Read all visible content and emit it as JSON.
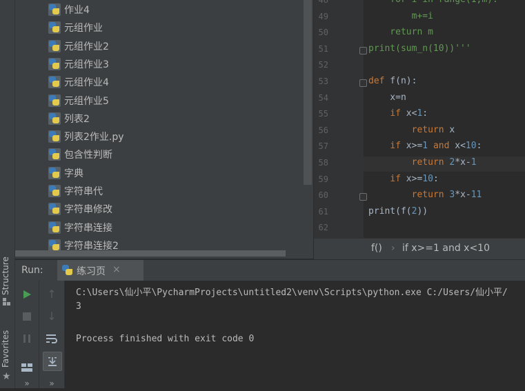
{
  "left_strip": {
    "structure_label": "Structure",
    "favorites_label": "Favorites"
  },
  "project_tree": {
    "items": [
      "作业4",
      "元组作业",
      "元组作业2",
      "元组作业3",
      "元组作业4",
      "元组作业5",
      "列表2",
      "列表2作业.py",
      "包含性判断",
      "字典",
      "字符串代",
      "字符串修改",
      "字符串连接",
      "字符串连接2"
    ]
  },
  "editor": {
    "line_numbers": [
      "48",
      "49",
      "50",
      "51",
      "52",
      "53",
      "54",
      "55",
      "56",
      "57",
      "58",
      "59",
      "60",
      "61",
      "62"
    ],
    "lines": [
      "    for i in range(1,m):",
      "        m+=i",
      "    return m",
      "print(sum_n(10))'''",
      "",
      "def f(n):",
      "    x=n",
      "    if x<1:",
      "        return x",
      "    if x>=1 and x<10:",
      "        return 2*x-1",
      "    if x>=10:",
      "        return 3*x-11",
      "print(f(2))",
      ""
    ],
    "breadcrumb": {
      "func": "f()",
      "separator": "›",
      "condition": "if x>=1 and x<10"
    }
  },
  "run": {
    "label": "Run:",
    "tab_label": "练习页",
    "tab_close": "×",
    "output": [
      "C:\\Users\\仙小平\\PycharmProjects\\untitled2\\venv\\Scripts\\python.exe C:/Users/仙小平/",
      "3",
      "",
      "Process finished with exit code 0"
    ],
    "more_label": "»"
  },
  "colors": {
    "keyword": "#cc7832",
    "number": "#6897bb",
    "comment": "#629755",
    "run_green": "#499c54"
  }
}
